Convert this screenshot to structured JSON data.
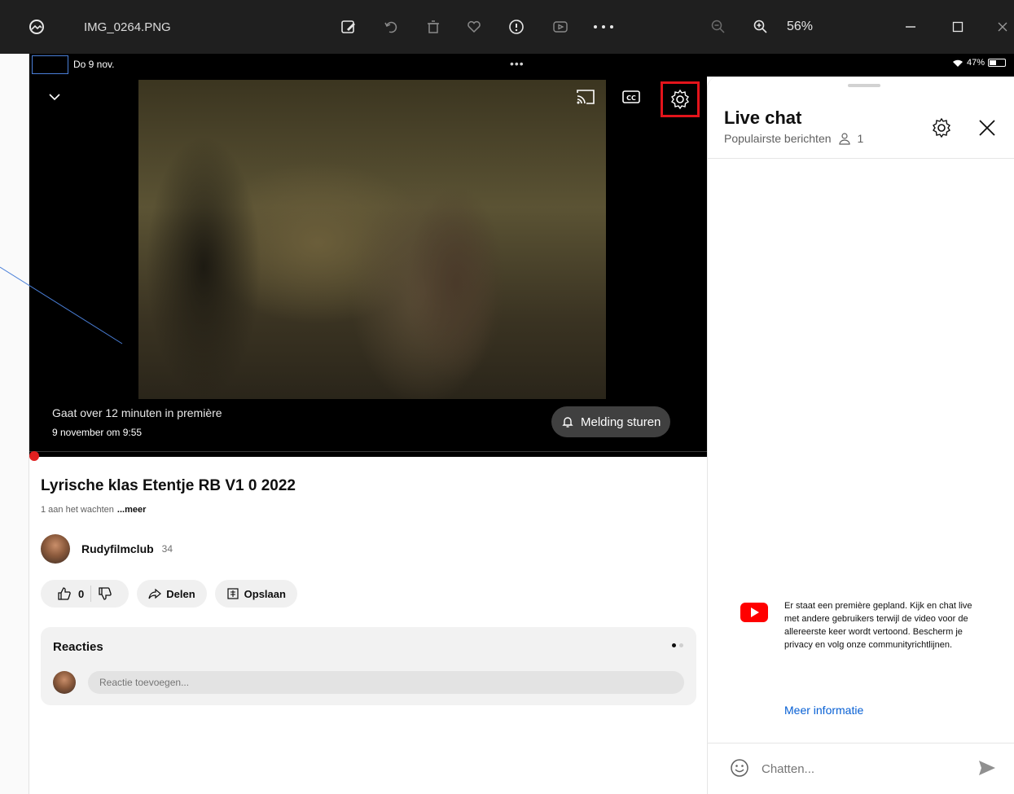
{
  "titlebar": {
    "file_name": "IMG_0264.PNG",
    "zoom": "56%",
    "icons": [
      "photos-app-icon",
      "edit-image-icon",
      "rotate-icon",
      "delete-icon",
      "favorite-icon",
      "info-icon",
      "slideshow-icon",
      "more-options-icon",
      "zoom-out-icon",
      "zoom-in-icon",
      "minimize-icon",
      "maximize-icon",
      "close-window-icon"
    ]
  },
  "status_bar": {
    "date": "Do 9 nov.",
    "dots": "•••",
    "battery": "47%",
    "battery_level": 0.47
  },
  "player": {
    "premiere_text": "Gaat over 12 minuten in première",
    "premiere_date": "9 november om 9:55",
    "notify_label": "Melding sturen"
  },
  "video": {
    "title": "Lyrische klas Etentje RB V1 0 2022",
    "waiting": "1 aan het wachten",
    "more": "...meer",
    "channel": "Rudyfilmclub",
    "subscribers": "34",
    "likes": "0",
    "share_label": "Delen",
    "save_label": "Opslaan"
  },
  "comments": {
    "title": "Reacties",
    "placeholder": "Reactie toevoegen..."
  },
  "chat": {
    "title": "Live chat",
    "subtitle": "Populairste berichten",
    "viewers": "1",
    "notice": "Er staat een première gepland. Kijk en chat live met andere gebruikers terwijl de video voor de allereerste keer wordt vertoond. Bescherm je privacy en volg onze communityrichtlijnen.",
    "more_info": "Meer informatie",
    "input_placeholder": "Chatten..."
  },
  "colors": {
    "highlight": "#e3141b",
    "link": "#065fd4",
    "youtube_red": "#ff0000"
  }
}
